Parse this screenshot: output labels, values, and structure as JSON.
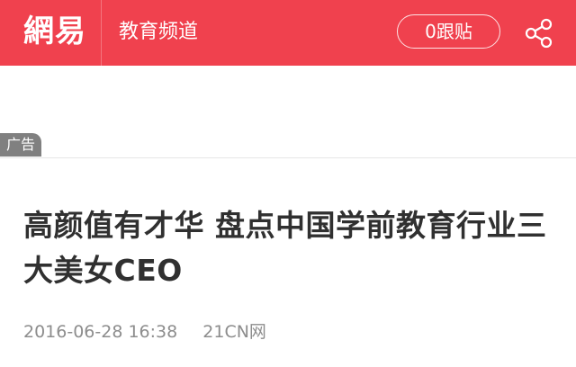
{
  "header": {
    "logo": "網易",
    "channel": "教育频道",
    "comment_button": "0跟贴",
    "share_icon": "share-icon"
  },
  "ad": {
    "tag": "广告"
  },
  "article": {
    "title": "高颜值有才华 盘点中国学前教育行业三大美女CEO",
    "date": "2016-06-28 16:38",
    "source": "21CN网"
  },
  "colors": {
    "header_bg": "#f0414e",
    "title_text": "#303030",
    "meta_text": "#8d8d8d",
    "ad_tag_bg": "#808080"
  }
}
